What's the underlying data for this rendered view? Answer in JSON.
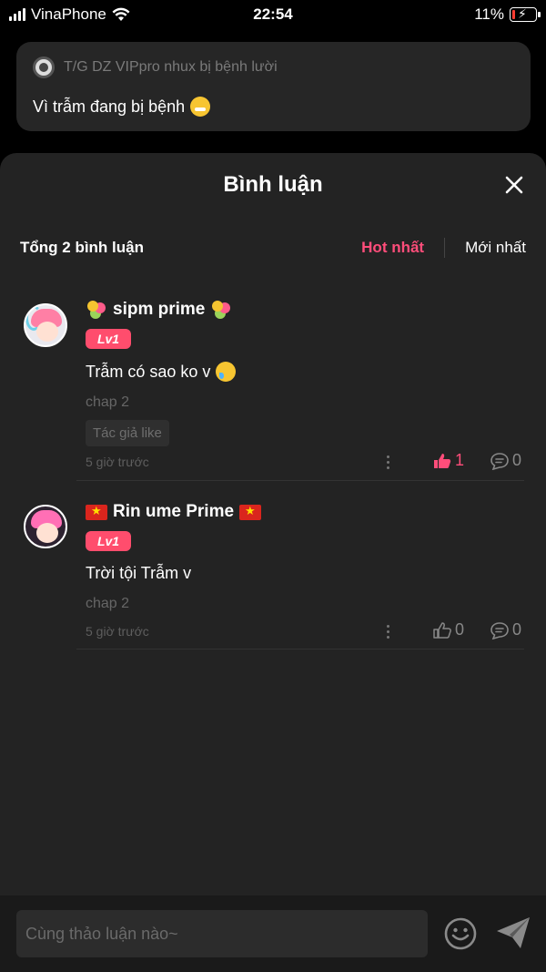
{
  "status_bar": {
    "carrier": "VinaPhone",
    "time": "22:54",
    "battery_text": "11%",
    "battery_level": 0.11
  },
  "post": {
    "author_line": "T/G DZ VIPpro nhux bị bệnh lười",
    "text": "Vì trẫm đang bị bệnh",
    "emoji": "sneezing-face-emoji"
  },
  "sheet": {
    "title": "Bình luận",
    "total": "Tổng 2 bình luận",
    "filters": {
      "hot": "Hot nhất",
      "new": "Mới nhất"
    }
  },
  "comments": [
    {
      "name": "sipm prime",
      "level": "Lv1",
      "text": "Trẫm có sao ko v",
      "chapter": "chap 2",
      "tag": "Tác giả like",
      "time": "5 giờ trước",
      "likes": "1",
      "replies": "0",
      "liked": true
    },
    {
      "name": "Rin ume Prime",
      "level": "Lv1",
      "text": "Trời tội Trẫm v",
      "chapter": "chap 2",
      "time": "5 giờ trước",
      "likes": "0",
      "replies": "0",
      "liked": false
    }
  ],
  "input": {
    "placeholder": "Cùng thảo luận nào~"
  },
  "colors": {
    "accent": "#ff4d7a",
    "sheet_bg": "#232323",
    "card_bg": "#262626"
  }
}
